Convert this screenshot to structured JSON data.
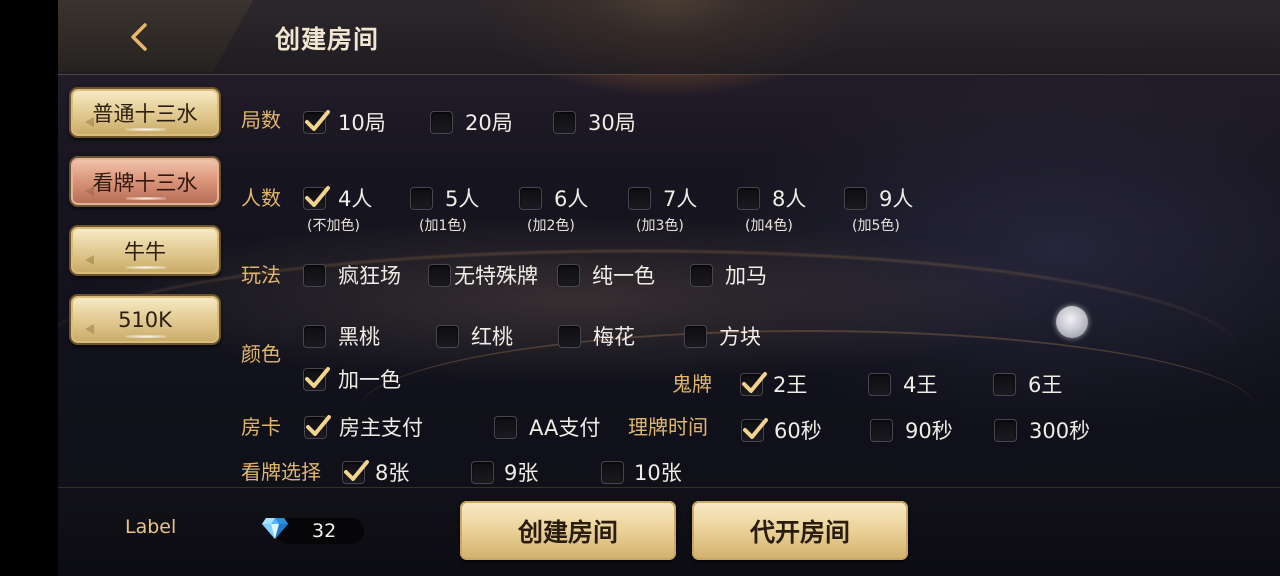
{
  "header": {
    "title": "创建房间",
    "back_icon": "chevron-left-icon"
  },
  "sidebar": {
    "games": [
      {
        "label": "普通十三水",
        "active": false
      },
      {
        "label": "看牌十三水",
        "active": true
      },
      {
        "label": "牛牛",
        "active": false
      },
      {
        "label": "510K",
        "active": false
      }
    ]
  },
  "options": {
    "rounds": {
      "label": "局数",
      "items": [
        {
          "label": "10局",
          "checked": true
        },
        {
          "label": "20局",
          "checked": false
        },
        {
          "label": "30局",
          "checked": false
        }
      ]
    },
    "players": {
      "label": "人数",
      "items": [
        {
          "label": "4人",
          "sub": "(不加色)",
          "checked": true
        },
        {
          "label": "5人",
          "sub": "(加1色)",
          "checked": false
        },
        {
          "label": "6人",
          "sub": "(加2色)",
          "checked": false
        },
        {
          "label": "7人",
          "sub": "(加3色)",
          "checked": false
        },
        {
          "label": "8人",
          "sub": "(加4色)",
          "checked": false
        },
        {
          "label": "9人",
          "sub": "(加5色)",
          "checked": false
        }
      ]
    },
    "mode": {
      "label": "玩法",
      "items": [
        {
          "label": "疯狂场",
          "checked": false
        },
        {
          "label": "无特殊牌",
          "checked": false
        },
        {
          "label": "纯一色",
          "checked": false
        },
        {
          "label": "加马",
          "checked": false
        }
      ]
    },
    "color": {
      "label": "颜色",
      "items": [
        {
          "label": "黑桃",
          "checked": false
        },
        {
          "label": "红桃",
          "checked": false
        },
        {
          "label": "梅花",
          "checked": false
        },
        {
          "label": "方块",
          "checked": false
        },
        {
          "label": "加一色",
          "checked": true
        }
      ]
    },
    "ghost": {
      "label": "鬼牌",
      "items": [
        {
          "label": "2王",
          "checked": true
        },
        {
          "label": "4王",
          "checked": false
        },
        {
          "label": "6王",
          "checked": false
        }
      ]
    },
    "room_card": {
      "label": "房卡",
      "items": [
        {
          "label": "房主支付",
          "checked": true
        },
        {
          "label": "AA支付",
          "checked": false
        }
      ]
    },
    "arrange_time": {
      "label": "理牌时间",
      "items": [
        {
          "label": "60秒",
          "checked": true
        },
        {
          "label": "90秒",
          "checked": false
        },
        {
          "label": "300秒",
          "checked": false
        }
      ]
    },
    "view_cards": {
      "label": "看牌选择",
      "items": [
        {
          "label": "8张",
          "checked": true
        },
        {
          "label": "9张",
          "checked": false
        },
        {
          "label": "10张",
          "checked": false
        }
      ]
    }
  },
  "footer": {
    "user_label": "Label",
    "gem_icon": "diamond-icon",
    "card_count": "32",
    "create_button": "创建房间",
    "proxy_button": "代开房间"
  },
  "colors": {
    "accent_gold": "#e0b66f",
    "button_gold": "#ead197",
    "active_tab": "#d99378"
  }
}
